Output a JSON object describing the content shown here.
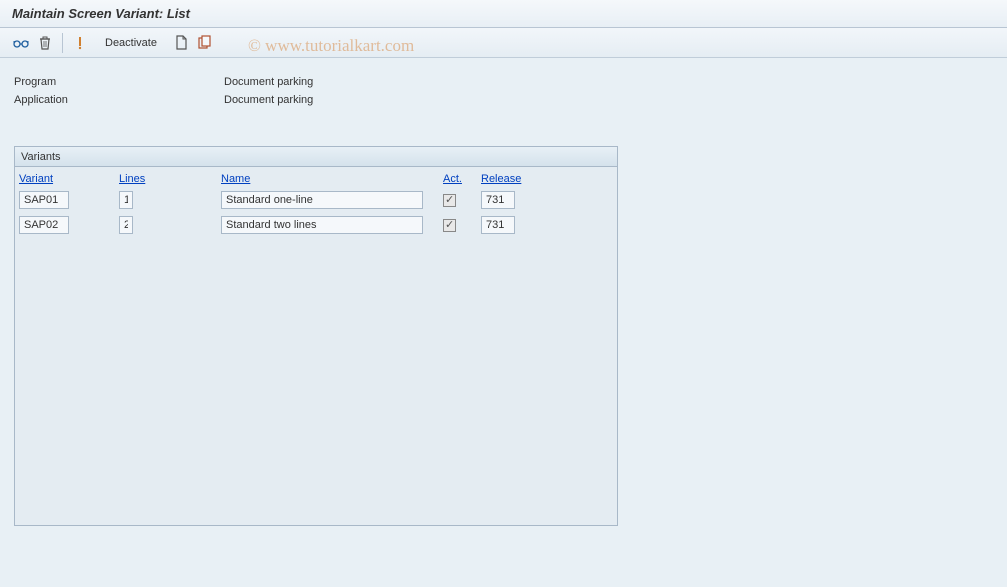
{
  "title": "Maintain Screen Variant: List",
  "toolbar": {
    "deactivate_label": "Deactivate"
  },
  "info": {
    "program_label": "Program",
    "program_value": "Document parking",
    "application_label": "Application",
    "application_value": "Document parking"
  },
  "variants_panel": {
    "title": "Variants",
    "headers": {
      "variant": "Variant",
      "lines": "Lines",
      "name": "Name",
      "act": "Act.",
      "release": "Release"
    },
    "rows": [
      {
        "variant": "SAP01",
        "lines": "1",
        "name": "Standard one-line",
        "act": true,
        "release": "731"
      },
      {
        "variant": "SAP02",
        "lines": "2",
        "name": "Standard two lines",
        "act": true,
        "release": "731"
      }
    ]
  },
  "watermark": "© www.tutorialkart.com"
}
